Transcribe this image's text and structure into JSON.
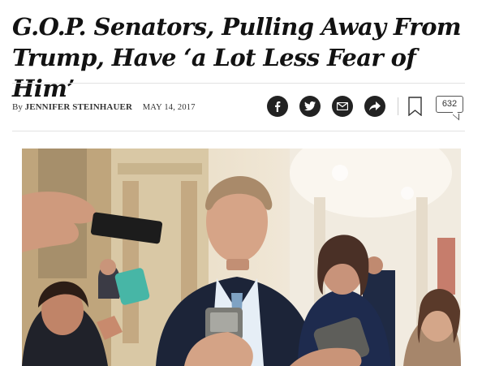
{
  "article": {
    "headline": "G.O.P. Senators, Pulling Away From Trump, Have ‘a Lot Less Fear of Him’",
    "byline_prefix": "By",
    "author": "JENNIFER STEINHAUER",
    "date": "MAY 14, 2017"
  },
  "share": {
    "icons": [
      "facebook-icon",
      "twitter-icon",
      "email-icon",
      "share-icon"
    ],
    "bookmark_icon": "bookmark-icon",
    "comment_count": "632"
  },
  "photo": {
    "description_icon": "article-photo"
  }
}
